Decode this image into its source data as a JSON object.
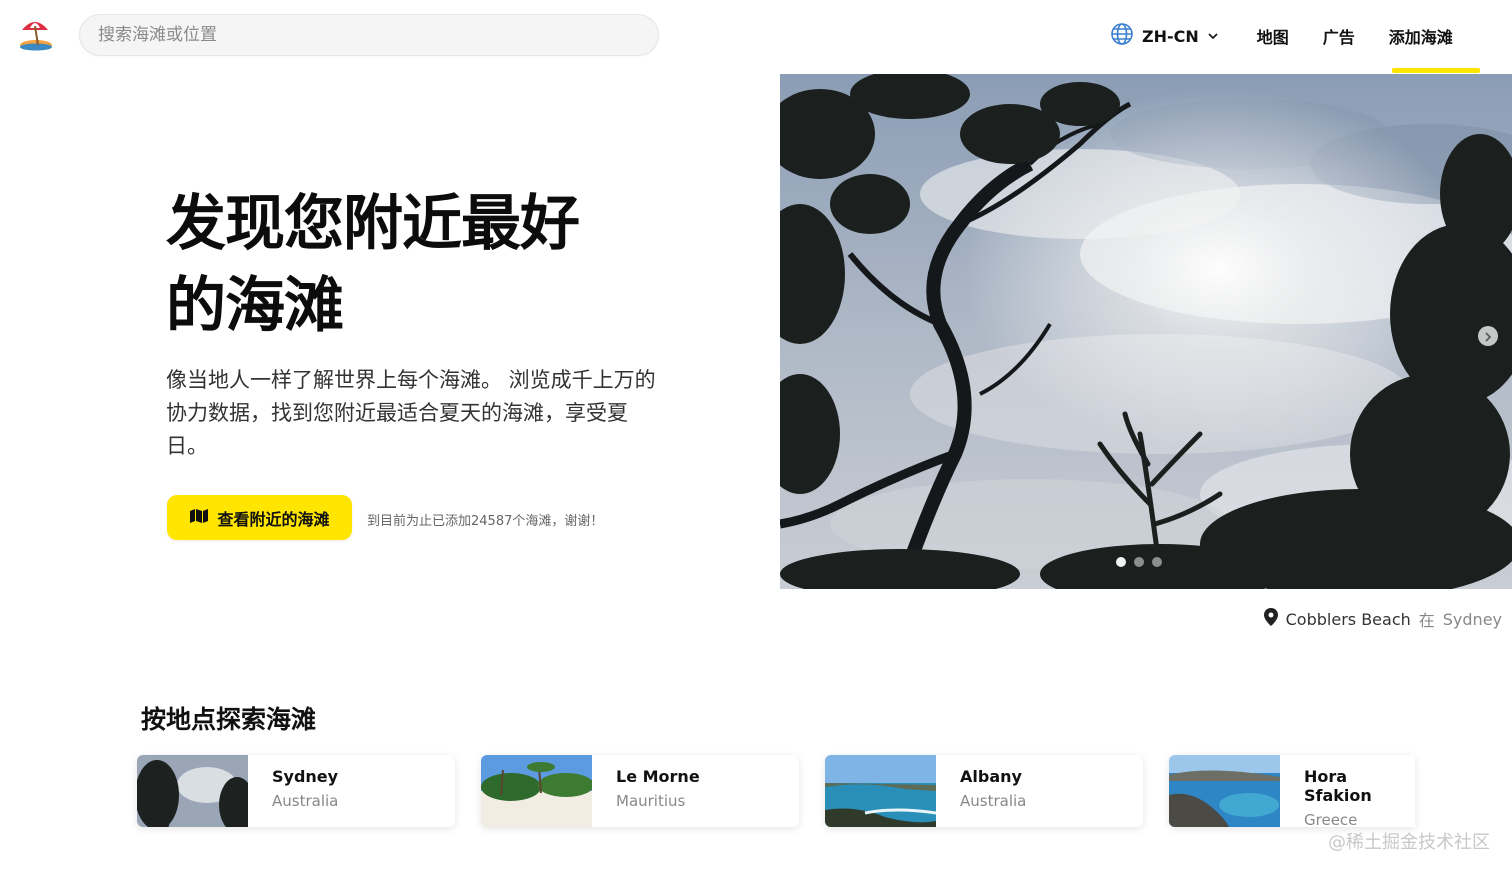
{
  "header": {
    "search_placeholder": "搜索海滩或位置",
    "language": "ZH-CN",
    "nav": [
      "地图",
      "广告",
      "添加海滩"
    ]
  },
  "hero": {
    "title_line1": "发现您附近最好",
    "title_line2": "的海滩",
    "description": "像当地人一样了解世界上每个海滩。 浏览成千上万的协力数据，找到您附近最适合夏天的海滩，享受夏日。",
    "cta_label": "查看附近的海滩",
    "count_note": "到目前为止已添加24587个海滩，谢谢！"
  },
  "photo": {
    "caption_place": "Cobblers Beach",
    "caption_sep": "在",
    "caption_city": "Sydney",
    "active_slide": 1,
    "slides": 3
  },
  "explore": {
    "title": "按地点探索海滩",
    "cards": [
      {
        "name": "Sydney",
        "country": "Australia"
      },
      {
        "name": "Le Morne",
        "country": "Mauritius"
      },
      {
        "name": "Albany",
        "country": "Australia"
      },
      {
        "name": "Hora Sfakion",
        "country": "Greece"
      }
    ]
  },
  "watermark": "@稀土掘金技术社区",
  "colors": {
    "accent": "#ffe500",
    "text": "#111111",
    "muted": "#888888"
  }
}
